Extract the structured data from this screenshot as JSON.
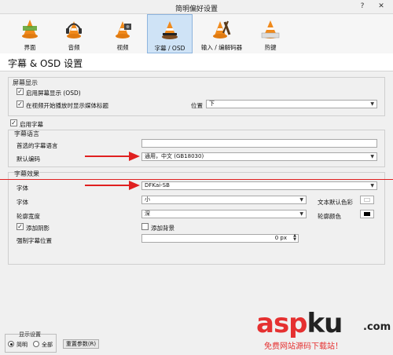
{
  "window": {
    "title": "简明偏好设置",
    "help_label": "?",
    "close_label": "✕"
  },
  "toolbar": {
    "items": [
      {
        "label": "界面"
      },
      {
        "label": "音频"
      },
      {
        "label": "视频"
      },
      {
        "label": "字幕 / OSD",
        "active": true
      },
      {
        "label": "输入 / 编解码器"
      },
      {
        "label": "热键"
      }
    ]
  },
  "page": {
    "heading": "字幕 & OSD 设置"
  },
  "osd": {
    "title": "屏幕显示",
    "enable_osd": {
      "label": "启用屏幕显示 (OSD)",
      "checked": true
    },
    "show_title": {
      "label": "在视频开始播放时显示媒体标题",
      "checked": true
    },
    "position_label": "位置",
    "position_value": "下"
  },
  "subs": {
    "enable": {
      "label": "启用字幕",
      "checked": true
    },
    "language_group": "字幕语言",
    "preferred_label": "首选的字幕语言",
    "preferred_value": "",
    "encoding_label": "默认编码",
    "encoding_value": "通用，中文 (GB18030)",
    "effects_group": "字幕效果",
    "font_label": "字体",
    "font_value": "DFKai-SB",
    "size_label": "字体",
    "size_value": "小",
    "text_color_label": "文本默认色彩",
    "outline_label": "轮廓宽度",
    "outline_value": "深",
    "outline_color_label": "轮廓颜色",
    "shadow": {
      "label": "添加阴影",
      "checked": true
    },
    "background": {
      "label": "添加背景",
      "checked": false
    },
    "force_pos_label": "强制字幕位置",
    "force_pos_value": "0 px"
  },
  "footer": {
    "group_title": "显示设置",
    "simple_label": "简明",
    "all_label": "全部",
    "reset_label": "重置参数(R)"
  },
  "watermark": {
    "brand_a": "asp",
    "brand_b": "ku",
    "brand_c": ".com",
    "tagline": "免费网站源码下载站！"
  },
  "colors": {
    "active_tab": "#cfe3f6",
    "annotation_red": "#e02020",
    "text_default_color": "#ffffff",
    "outline_color": "#000000"
  },
  "icons": {
    "tool_icon": "vlc-cone-icon",
    "annotation": "red-arrow-icon"
  }
}
